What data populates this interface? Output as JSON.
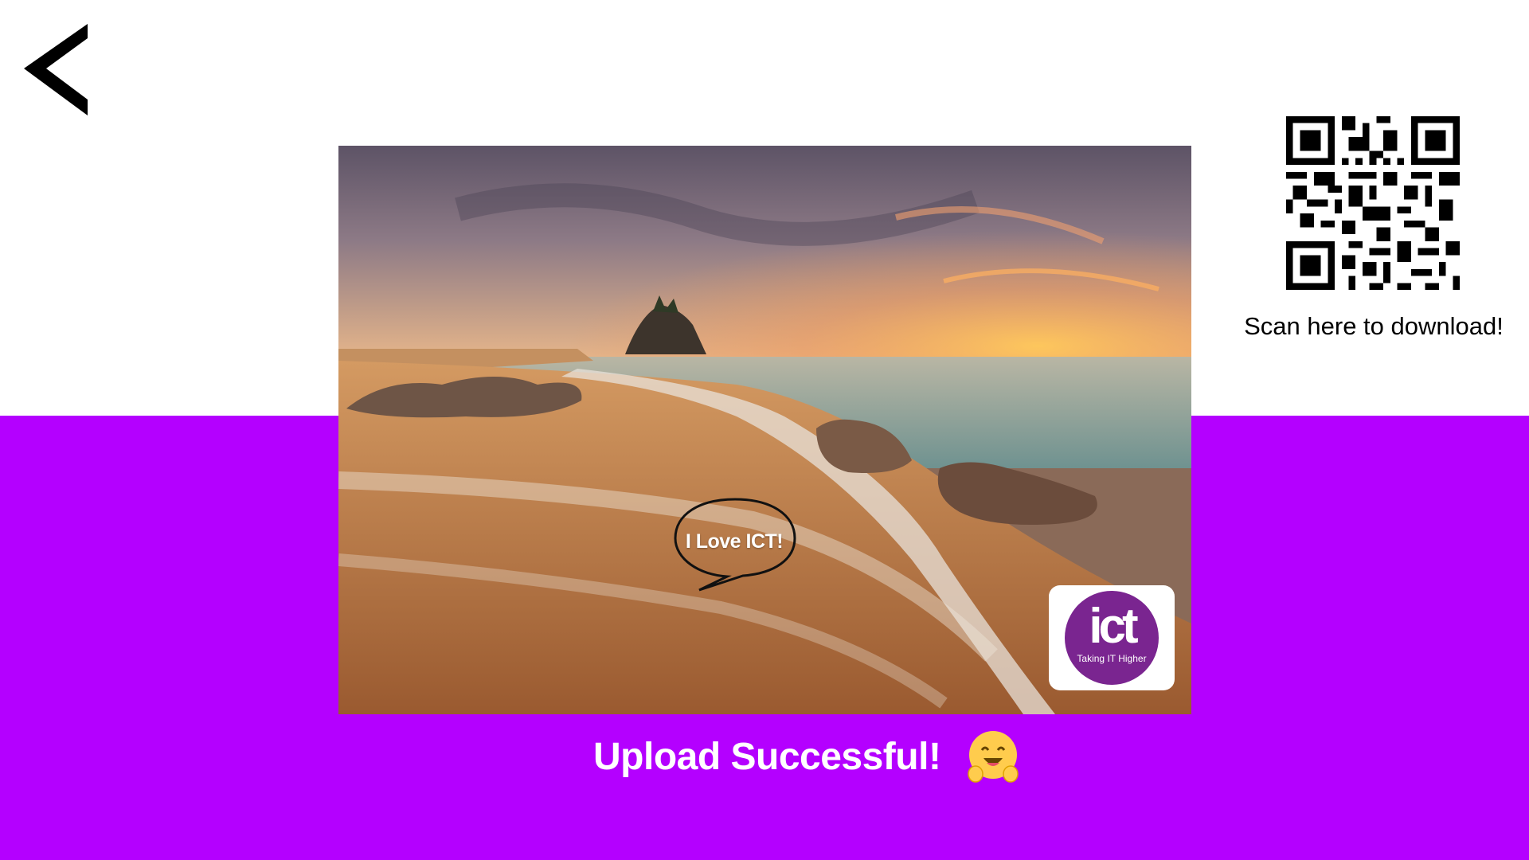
{
  "nav": {
    "back_icon": "chevron-left-icon"
  },
  "photo": {
    "description_icon": "beach-sunset-photo",
    "speech_bubble_text": "I Love ICT!",
    "logo": {
      "main": "ict",
      "tagline": "Taking IT Higher",
      "color": "#7a2590"
    }
  },
  "qr": {
    "caption": "Scan here to download!"
  },
  "status": {
    "message": "Upload Successful!",
    "emoji_icon": "hugging-face-icon"
  },
  "colors": {
    "band": "#b400ff",
    "background": "#ffffff",
    "text_light": "#ffffff"
  }
}
